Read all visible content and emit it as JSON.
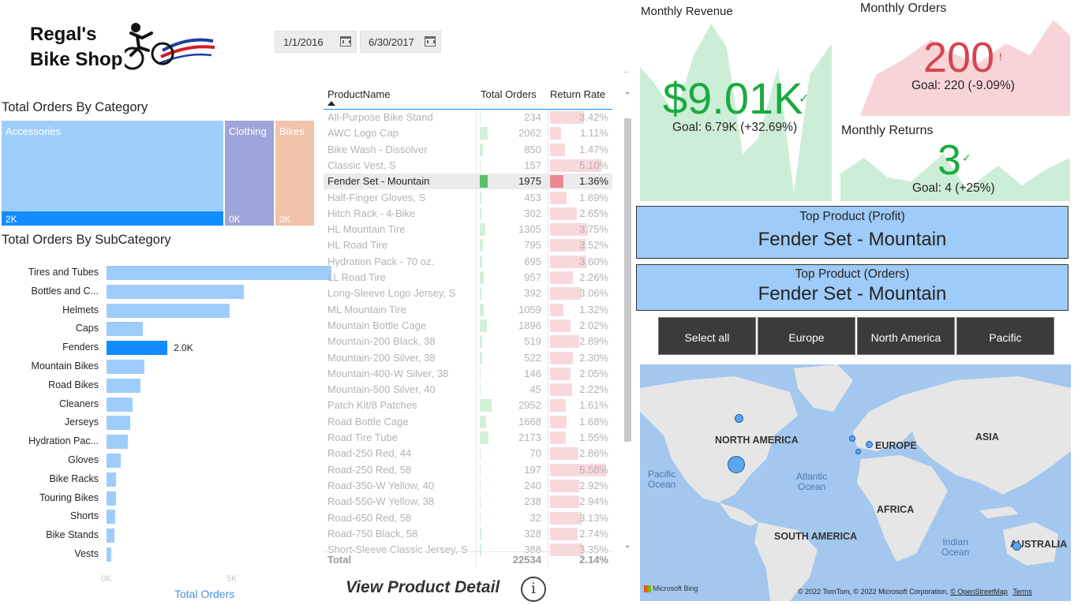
{
  "logo": {
    "line1": "Regal's",
    "line2": "Bike Shop"
  },
  "dates": {
    "start": "1/1/2016",
    "end": "6/30/2017"
  },
  "category": {
    "title": "Total Orders By Category",
    "cells": [
      {
        "name": "Accessories",
        "value": "2K",
        "color": "#9ecdfa"
      },
      {
        "name": "Clothing",
        "value": "0K",
        "color": "#9ea5d8"
      },
      {
        "name": "Bikes",
        "value": "0K",
        "color": "#f1c3ab"
      }
    ]
  },
  "subcategory": {
    "title": "Total Orders By SubCategory",
    "xlabel": "Total Orders",
    "ticks": [
      "0K",
      "5K"
    ],
    "highlight_label": "2.0K",
    "chart_data": {
      "type": "bar",
      "categories": [
        "Tires and Tubes",
        "Bottles and C...",
        "Helmets",
        "Caps",
        "Fenders",
        "Mountain Bikes",
        "Road Bikes",
        "Cleaners",
        "Jerseys",
        "Hydration Pac...",
        "Gloves",
        "Bike Racks",
        "Touring Bikes",
        "Shorts",
        "Bike Stands",
        "Vests"
      ],
      "values": [
        7300,
        4450,
        4000,
        1170,
        1975,
        1220,
        1100,
        850,
        780,
        695,
        453,
        302,
        300,
        280,
        250,
        160
      ],
      "xlim": [
        0,
        8000
      ],
      "highlighted": "Fenders"
    }
  },
  "table": {
    "headers": {
      "name": "ProductName",
      "orders": "Total Orders",
      "rate": "Return Rate"
    },
    "rows": [
      {
        "name": "All-Purpose Bike Stand",
        "orders": "234",
        "rate": "3.42%"
      },
      {
        "name": "AWC Logo Cap",
        "orders": "2062",
        "rate": "1.11%"
      },
      {
        "name": "Bike Wash - Dissolver",
        "orders": "850",
        "rate": "1.47%"
      },
      {
        "name": "Classic Vest, S",
        "orders": "157",
        "rate": "5.10%"
      },
      {
        "name": "Fender Set - Mountain",
        "orders": "1975",
        "rate": "1.36%"
      },
      {
        "name": "Half-Finger Gloves, S",
        "orders": "453",
        "rate": "1.69%"
      },
      {
        "name": "Hitch Rack - 4-Bike",
        "orders": "302",
        "rate": "2.65%"
      },
      {
        "name": "HL Mountain Tire",
        "orders": "1305",
        "rate": "3.75%"
      },
      {
        "name": "HL Road Tire",
        "orders": "795",
        "rate": "3.52%"
      },
      {
        "name": "Hydration Pack - 70 oz.",
        "orders": "695",
        "rate": "3.60%"
      },
      {
        "name": "LL Road Tire",
        "orders": "957",
        "rate": "2.26%"
      },
      {
        "name": "Long-Sleeve Logo Jersey, S",
        "orders": "392",
        "rate": "3.06%"
      },
      {
        "name": "ML Mountain Tire",
        "orders": "1059",
        "rate": "1.32%"
      },
      {
        "name": "Mountain Bottle Cage",
        "orders": "1896",
        "rate": "2.02%"
      },
      {
        "name": "Mountain-200 Black, 38",
        "orders": "519",
        "rate": "2.89%"
      },
      {
        "name": "Mountain-200 Silver, 38",
        "orders": "522",
        "rate": "2.30%"
      },
      {
        "name": "Mountain-400-W Silver, 38",
        "orders": "146",
        "rate": "2.05%"
      },
      {
        "name": "Mountain-500 Silver, 40",
        "orders": "45",
        "rate": "2.22%"
      },
      {
        "name": "Patch Kit/8 Patches",
        "orders": "2952",
        "rate": "1.61%"
      },
      {
        "name": "Road Bottle Cage",
        "orders": "1668",
        "rate": "1.68%"
      },
      {
        "name": "Road Tire Tube",
        "orders": "2173",
        "rate": "1.55%"
      },
      {
        "name": "Road-250 Red, 44",
        "orders": "70",
        "rate": "2.86%"
      },
      {
        "name": "Road-250 Red, 58",
        "orders": "197",
        "rate": "5.58%"
      },
      {
        "name": "Road-350-W Yellow, 40",
        "orders": "240",
        "rate": "2.92%"
      },
      {
        "name": "Road-550-W Yellow, 38",
        "orders": "238",
        "rate": "2.94%"
      },
      {
        "name": "Road-650 Red, 58",
        "orders": "32",
        "rate": "3.13%"
      },
      {
        "name": "Road-750 Black, 58",
        "orders": "328",
        "rate": "2.74%"
      },
      {
        "name": "Short-Sleeve Classic Jersey, S",
        "orders": "388",
        "rate": "3.35%"
      }
    ],
    "selected_index": 4,
    "total": {
      "label": "Total",
      "orders": "22534",
      "rate": "2.14%"
    }
  },
  "detail_link": "View Product Detail",
  "kpis": {
    "revenue": {
      "title": "Monthly Revenue",
      "value": "$9.01K",
      "goal": "Goal: 6.79K (+32.69%)",
      "color": "#1aab40"
    },
    "orders": {
      "title": "Monthly Orders",
      "value": "200",
      "goal": "Goal: 220 (-9.09%)",
      "color": "#d64550",
      "mark": "!"
    },
    "returns": {
      "title": "Monthly Returns",
      "value": "3",
      "goal": "Goal: 4 (+25%)",
      "color": "#1aab40"
    }
  },
  "top_profit": {
    "title": "Top Product (Profit)",
    "value": "Fender Set - Mountain"
  },
  "top_orders": {
    "title": "Top Product (Orders)",
    "value": "Fender Set - Mountain"
  },
  "regions": [
    "Select all",
    "Europe",
    "North America",
    "Pacific"
  ],
  "map": {
    "continents": [
      "NORTH AMERICA",
      "EUROPE",
      "ASIA",
      "AFRICA",
      "SOUTH AMERICA",
      "AUSTRALIA"
    ],
    "oceans": [
      {
        "name": "Pacific Ocean",
        "l1": "Pacific",
        "l2": "Ocean"
      },
      {
        "name": "Atlantic Ocean",
        "l1": "Atlantic",
        "l2": "Ocean"
      },
      {
        "name": "Indian Ocean",
        "l1": "Indian",
        "l2": "Ocean"
      }
    ],
    "brand": "Microsoft Bing",
    "copyright": "© 2022 TomTom, © 2022 Microsoft Corporation,",
    "osm": "© OpenStreetMap",
    "terms": "Terms"
  },
  "colors": {
    "accent_blue": "#118dff",
    "light_blue": "#9fcdfb",
    "kpi_green_bg": "#cdeed6",
    "kpi_red_bg": "#f7d4d8"
  }
}
